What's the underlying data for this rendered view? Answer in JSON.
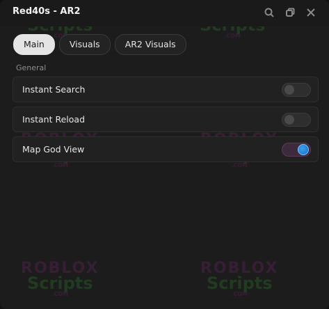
{
  "window": {
    "title": "Red40s - AR2"
  },
  "tabs": [
    {
      "label": "Main",
      "active": true
    },
    {
      "label": "Visuals",
      "active": false
    },
    {
      "label": "AR2 Visuals",
      "active": false
    }
  ],
  "section": {
    "label": "General"
  },
  "options": [
    {
      "label": "Instant Search",
      "enabled": false
    },
    {
      "label": "Instant Reload",
      "enabled": false
    },
    {
      "label": "Map God View",
      "enabled": true
    }
  ],
  "watermark": {
    "top": "ROBLOX",
    "bottom": "Scripts",
    "com": ".COM"
  },
  "colors": {
    "accent": "#2b8ee8",
    "toggle_on_track": "#3d2a3d",
    "background": "#1c1c1c"
  },
  "icons": {
    "search": "search-icon",
    "copy": "copy-icon",
    "close": "close-icon"
  }
}
